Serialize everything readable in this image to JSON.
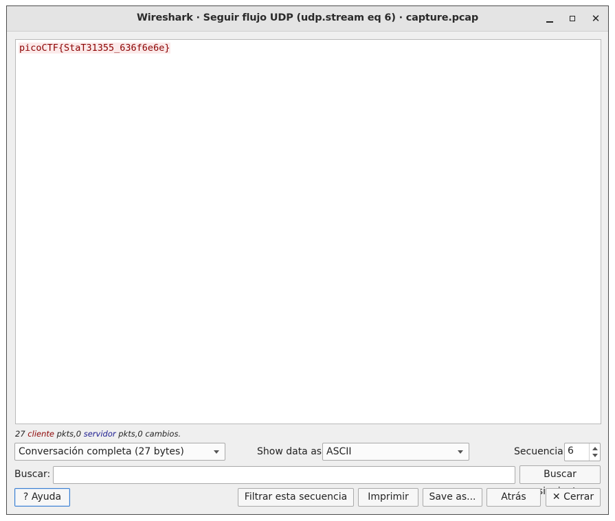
{
  "window": {
    "title": "Wireshark · Seguir flujo UDP (udp.stream eq 6) · capture.pcap",
    "controls": [
      "minimize-icon",
      "maximize-icon",
      "close-icon"
    ]
  },
  "stream": {
    "content": "picoCTF{StaT31355_636f6e6e}",
    "client_color": "#8b0000",
    "client_bg": "#fbeaea"
  },
  "stats": {
    "client_count": "27",
    "client_word": "cliente",
    "client_suffix": "pkts,",
    "server_count": "0",
    "server_word": "servidor",
    "server_suffix": "pkts,",
    "turns": "0 cambios."
  },
  "controls": {
    "conversation": "Conversación completa (27 bytes)",
    "show_data_label": "Show data as",
    "show_data_value": "ASCII",
    "stream_label": "Secuencia",
    "stream_value": "6",
    "find_label": "Buscar:",
    "find_value": "",
    "find_next": "Buscar siguiente"
  },
  "buttons": {
    "help": "Ayuda",
    "filter_out": "Filtrar esta secuencia",
    "print": "Imprimir",
    "save_as": "Save as...",
    "back": "Atrás",
    "close": "Cerrar"
  },
  "colors": {
    "server_color": "#1a1a8f",
    "focus_border": "#3b7fd1"
  }
}
